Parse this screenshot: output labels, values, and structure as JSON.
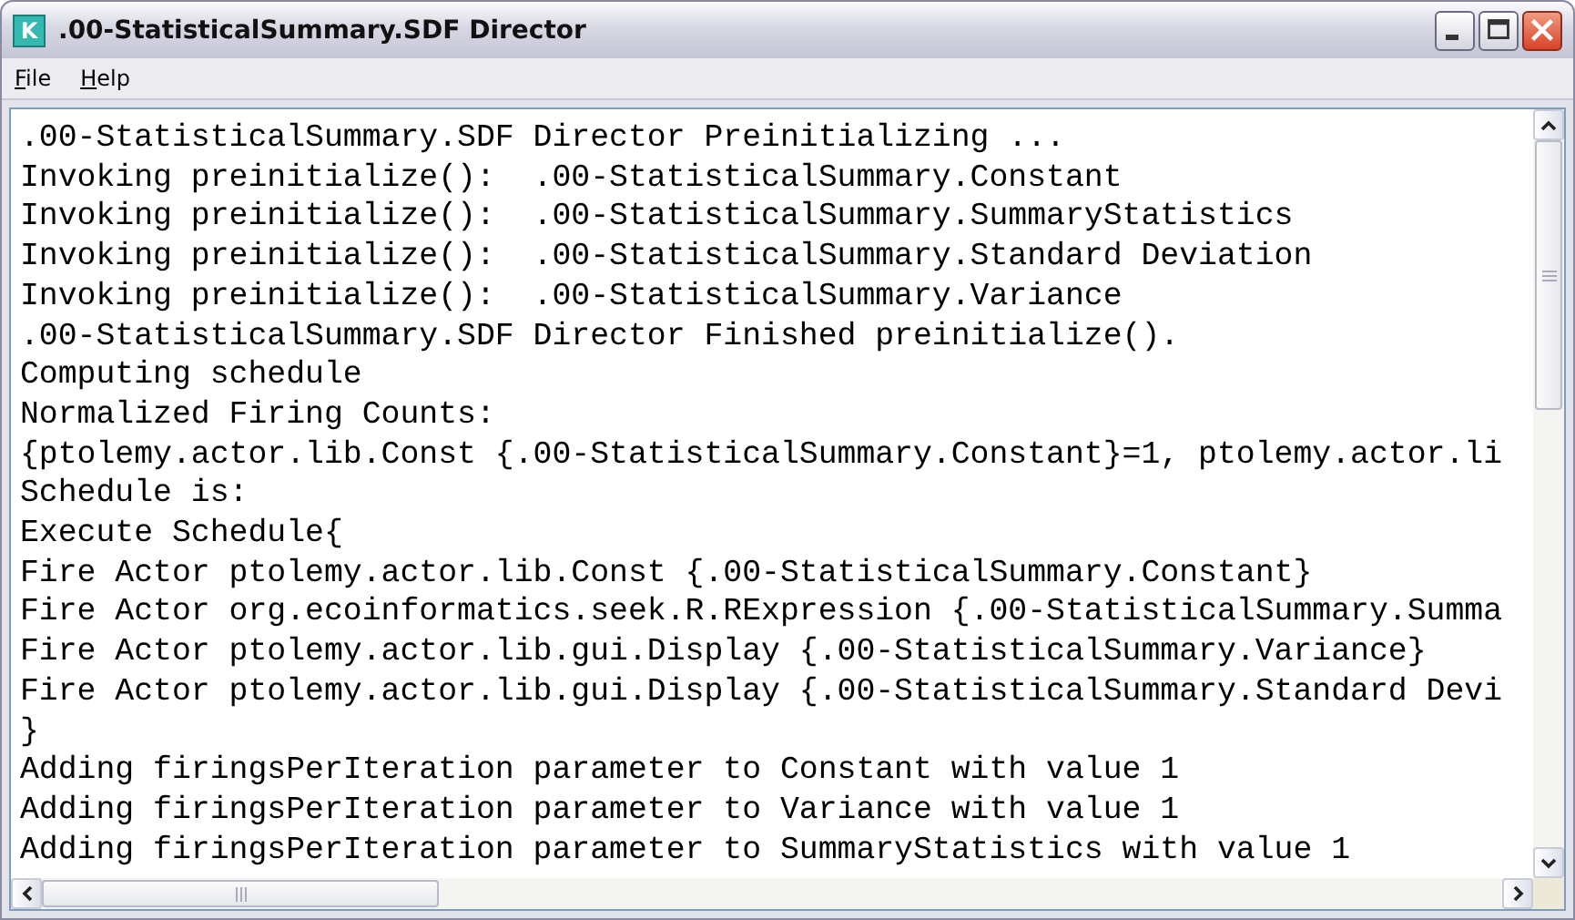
{
  "window": {
    "title": ".00-StatisticalSummary.SDF Director",
    "app_icon_letter": "K"
  },
  "menu": [
    "File",
    "Help"
  ],
  "log_lines": [
    ".00-StatisticalSummary.SDF Director Preinitializing ...",
    "Invoking preinitialize():  .00-StatisticalSummary.Constant",
    "Invoking preinitialize():  .00-StatisticalSummary.SummaryStatistics",
    "Invoking preinitialize():  .00-StatisticalSummary.Standard Deviation",
    "Invoking preinitialize():  .00-StatisticalSummary.Variance",
    ".00-StatisticalSummary.SDF Director Finished preinitialize().",
    "Computing schedule",
    "Normalized Firing Counts:",
    "{ptolemy.actor.lib.Const {.00-StatisticalSummary.Constant}=1, ptolemy.actor.li",
    "Schedule is:",
    "Execute Schedule{",
    "Fire Actor ptolemy.actor.lib.Const {.00-StatisticalSummary.Constant}",
    "Fire Actor org.ecoinformatics.seek.R.RExpression {.00-StatisticalSummary.Summa",
    "Fire Actor ptolemy.actor.lib.gui.Display {.00-StatisticalSummary.Variance}",
    "Fire Actor ptolemy.actor.lib.gui.Display {.00-StatisticalSummary.Standard Devi",
    "}",
    "Adding firingsPerIteration parameter to Constant with value 1",
    "Adding firingsPerIteration parameter to Variance with value 1",
    "Adding firingsPerIteration parameter to SummaryStatistics with value 1"
  ]
}
